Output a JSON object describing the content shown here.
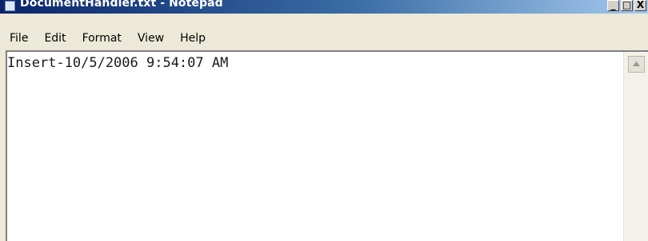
{
  "window": {
    "title": "DocumentHandler.txt - Notepad",
    "caption_buttons": {
      "minimize": "_",
      "maximize": "□",
      "close": "X"
    }
  },
  "menu": {
    "file": "File",
    "edit": "Edit",
    "format": "Format",
    "view": "View",
    "help": "Help"
  },
  "editor": {
    "content": "Insert-10/5/2006 9:54:07 AM"
  },
  "icons": {
    "app": "notepad-icon",
    "scroll_up": "scroll-up-arrow-icon"
  },
  "colors": {
    "titlebar_start": "#0a246a",
    "titlebar_end": "#a6caf0",
    "window_face": "#ece9d8",
    "editor_bg": "#ffffff"
  }
}
